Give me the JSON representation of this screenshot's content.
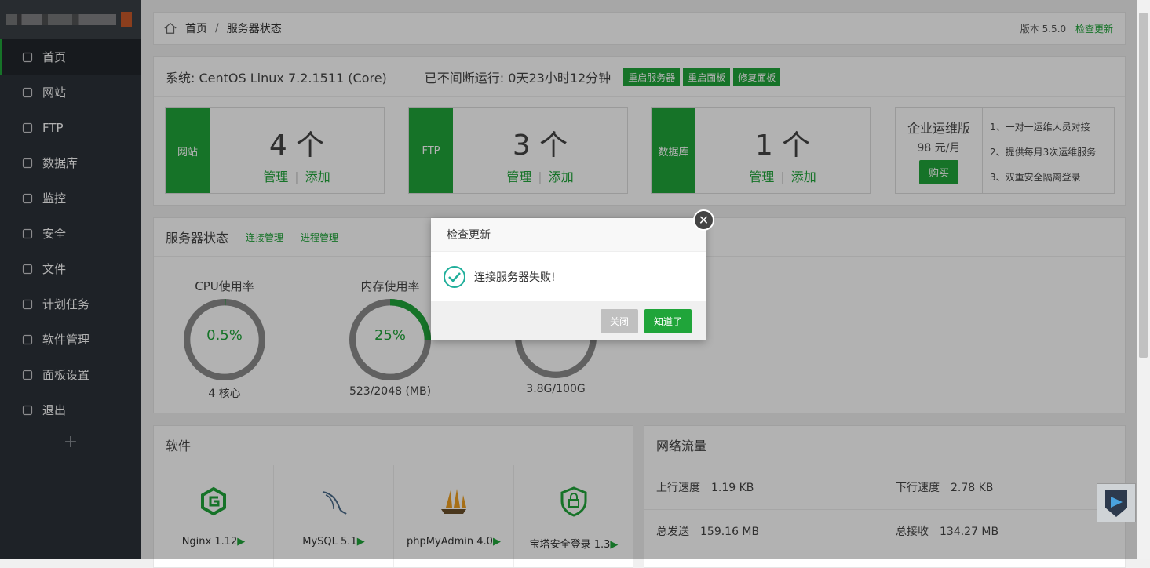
{
  "colors": {
    "accent": "#20a53a",
    "sidebar": "#2c3138",
    "gauge_track": "#8c8c8c"
  },
  "sidebar": {
    "items": [
      {
        "label": "首页",
        "icon": "home-icon"
      },
      {
        "label": "网站",
        "icon": "globe-icon"
      },
      {
        "label": "FTP",
        "icon": "ftp-icon"
      },
      {
        "label": "数据库",
        "icon": "database-icon"
      },
      {
        "label": "监控",
        "icon": "monitor-icon"
      },
      {
        "label": "安全",
        "icon": "shield-icon"
      },
      {
        "label": "文件",
        "icon": "folder-icon"
      },
      {
        "label": "计划任务",
        "icon": "calendar-icon"
      },
      {
        "label": "软件管理",
        "icon": "grid-icon"
      },
      {
        "label": "面板设置",
        "icon": "gear-icon"
      },
      {
        "label": "退出",
        "icon": "logout-icon"
      }
    ],
    "add": "+"
  },
  "breadcrumb": {
    "home": "首页",
    "sep": "/",
    "current": "服务器状态",
    "version_label": "版本 5.5.0",
    "check_update": "检查更新"
  },
  "system": {
    "os": "系统: CentOS Linux 7.2.1511 (Core)",
    "uptime": "已不间断运行: 0天23小时12分钟",
    "btn_restart_server": "重启服务器",
    "btn_restart_panel": "重启面板",
    "btn_repair": "修复面板"
  },
  "stats": [
    {
      "label": "网站",
      "count": "4 个",
      "manage": "管理",
      "add": "添加"
    },
    {
      "label": "FTP",
      "count": "3 个",
      "manage": "管理",
      "add": "添加"
    },
    {
      "label": "数据库",
      "count": "1 个",
      "manage": "管理",
      "add": "添加"
    }
  ],
  "enterprise": {
    "title": "企业运维版",
    "price": "98 元/月",
    "buy": "购买",
    "features": [
      "1、一对一运维人员对接",
      "2、提供每月3次运维服务",
      "3、双重安全隔离登录"
    ]
  },
  "server": {
    "title": "服务器状态",
    "link_conn": "连接管理",
    "link_proc": "进程管理",
    "gauges": [
      {
        "label": "CPU使用率",
        "value": "0.5%",
        "percent": 0.5,
        "sub": "4 核心"
      },
      {
        "label": "内存使用率",
        "value": "25%",
        "percent": 25,
        "sub": "523/2048 (MB)"
      },
      {
        "label": "",
        "value": "",
        "percent": 4,
        "sub": "3.8G/100G"
      }
    ]
  },
  "software": {
    "title": "软件",
    "items": [
      {
        "name": "Nginx 1.12",
        "icon": "nginx-icon"
      },
      {
        "name": "MySQL 5.1",
        "icon": "mysql-icon"
      },
      {
        "name": "phpMyAdmin 4.0",
        "icon": "phpmyadmin-icon"
      },
      {
        "name": "宝塔安全登录 1.3",
        "icon": "lock-shield-icon"
      }
    ],
    "arrow": "▶"
  },
  "network": {
    "title": "网络流量",
    "up_label": "上行速度",
    "up_value": "1.19 KB",
    "down_label": "下行速度",
    "down_value": "2.78 KB",
    "sent_label": "总发送",
    "sent_value": "159.16 MB",
    "recv_label": "总接收",
    "recv_value": "134.27 MB"
  },
  "dialog": {
    "title": "检查更新",
    "message": "连接服务器失败!",
    "close": "关闭",
    "ok": "知道了"
  }
}
